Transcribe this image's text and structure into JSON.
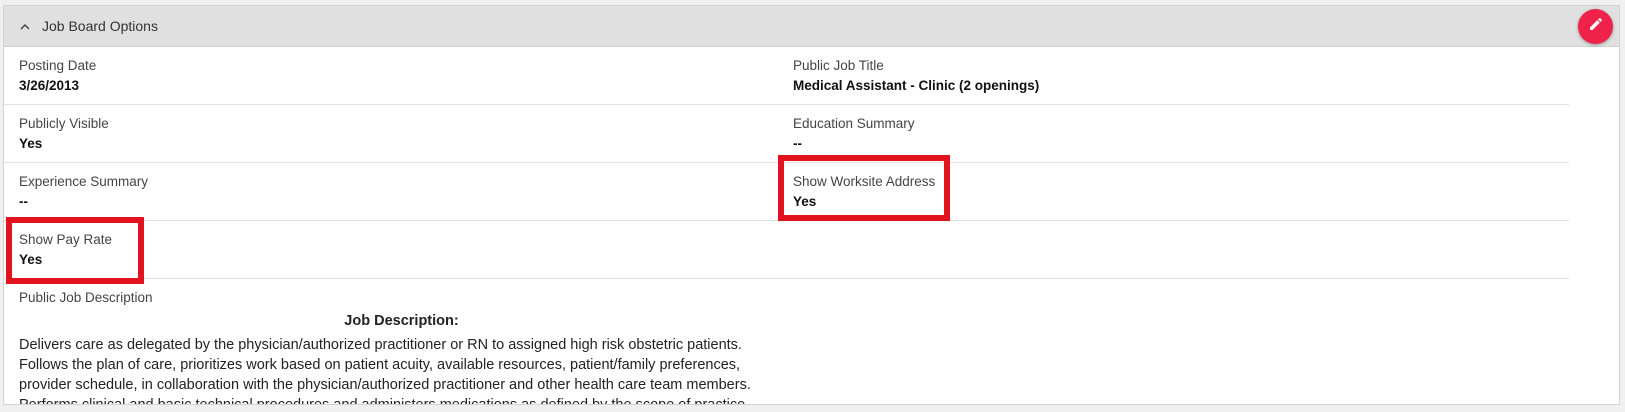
{
  "panel": {
    "title": "Job Board Options"
  },
  "fields": {
    "posting_date": {
      "label": "Posting Date",
      "value": "3/26/2013"
    },
    "public_job_title": {
      "label": "Public Job Title",
      "value": "Medical Assistant - Clinic (2 openings)"
    },
    "publicly_visible": {
      "label": "Publicly Visible",
      "value": "Yes"
    },
    "education_summary": {
      "label": "Education Summary",
      "value": "--"
    },
    "experience_summary": {
      "label": "Experience Summary",
      "value": "--"
    },
    "show_worksite_address": {
      "label": "Show Worksite Address",
      "value": "Yes"
    },
    "show_pay_rate": {
      "label": "Show Pay Rate",
      "value": "Yes"
    },
    "public_job_description": {
      "label": "Public Job Description",
      "heading": "Job Description:",
      "text": "Delivers care as delegated by the physician/authorized practitioner or RN to assigned high risk obstetric patients. Follows the plan of care, prioritizes work based on patient  acuity, available resources, patient/family preferences, provider schedule, in collaboration with the physician/authorized practitioner and other health care team members. Performs clinical and basic technical procedures and administers medications as defined by the scope of practice."
    }
  },
  "colors": {
    "edit_button": "#f0224a",
    "highlight_box": "#e3121f",
    "header_bg": "#e0e0e0"
  },
  "icons": {
    "collapse": "chevron-up-icon",
    "edit": "pencil-icon"
  }
}
